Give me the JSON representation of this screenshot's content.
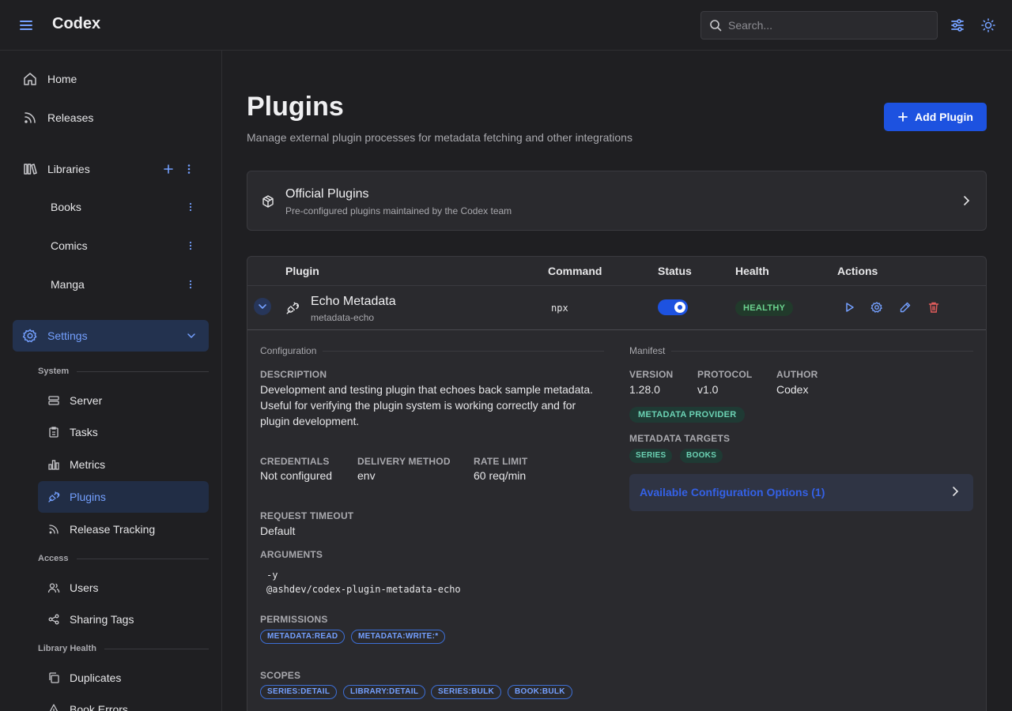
{
  "header": {
    "brand": "Codex",
    "search_placeholder": "Search..."
  },
  "sidebar": {
    "home": "Home",
    "releases": "Releases",
    "libraries": "Libraries",
    "library_items": [
      "Books",
      "Comics",
      "Manga"
    ],
    "settings": "Settings",
    "system_label": "System",
    "system_items": [
      "Server",
      "Tasks",
      "Metrics",
      "Plugins",
      "Release Tracking"
    ],
    "access_label": "Access",
    "access_items": [
      "Users",
      "Sharing Tags"
    ],
    "health_label": "Library Health",
    "health_items": [
      "Duplicates",
      "Book Errors"
    ]
  },
  "page": {
    "title": "Plugins",
    "subtitle": "Manage external plugin processes for metadata fetching and other integrations",
    "add_button": "Add Plugin"
  },
  "official": {
    "title": "Official Plugins",
    "subtitle": "Pre-configured plugins maintained by the Codex team"
  },
  "table": {
    "headers": {
      "plugin": "Plugin",
      "command": "Command",
      "status": "Status",
      "health": "Health",
      "actions": "Actions"
    },
    "row": {
      "name": "Echo Metadata",
      "id": "metadata-echo",
      "command": "npx",
      "enabled": true,
      "health": "HEALTHY"
    }
  },
  "detail": {
    "config_heading": "Configuration",
    "manifest_heading": "Manifest",
    "description_label": "DESCRIPTION",
    "description": "Development and testing plugin that echoes back sample metadata. Useful for verifying the plugin system is working correctly and for plugin development.",
    "credentials_label": "CREDENTIALS",
    "credentials": "Not configured",
    "delivery_label": "DELIVERY METHOD",
    "delivery": "env",
    "rate_label": "RATE LIMIT",
    "rate": "60 req/min",
    "timeout_label": "REQUEST TIMEOUT",
    "timeout": "Default",
    "arguments_label": "ARGUMENTS",
    "arguments": [
      "-y",
      "@ashdev/codex-plugin-metadata-echo"
    ],
    "permissions_label": "PERMISSIONS",
    "permissions": [
      "METADATA:READ",
      "METADATA:WRITE:*"
    ],
    "scopes_label": "SCOPES",
    "scopes": [
      "SERIES:DETAIL",
      "LIBRARY:DETAIL",
      "SERIES:BULK",
      "BOOK:BULK"
    ],
    "version_label": "VERSION",
    "version": "1.28.0",
    "protocol_label": "PROTOCOL",
    "protocol": "v1.0",
    "author_label": "AUTHOR",
    "author": "Codex",
    "capability": "METADATA PROVIDER",
    "targets_label": "METADATA TARGETS",
    "targets": [
      "SERIES",
      "BOOKS"
    ],
    "config_options": "Available Configuration Options (1)"
  },
  "colors": {
    "accent": "#1d52e0",
    "active_text": "#74a0ff",
    "healthy": "#6bd28e",
    "delete": "#e25c5c"
  }
}
